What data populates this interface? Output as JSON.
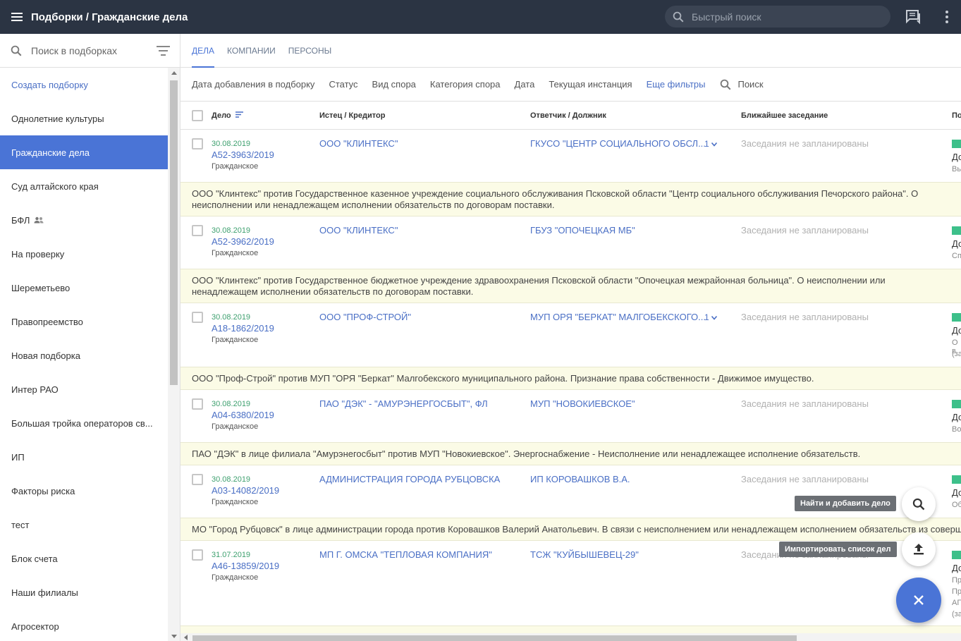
{
  "header": {
    "title": "Подборки / Гражданские дела",
    "search_placeholder": "Быстрый поиск",
    "menu_icon": "menu-icon",
    "chat_icon": "chat-icon",
    "more_icon": "more-vert-icon"
  },
  "sidebar": {
    "search_placeholder": "Поиск в подборках",
    "items": [
      {
        "label": "Создать подборку"
      },
      {
        "label": "Однолетние культуры"
      },
      {
        "label": "Гражданские дела"
      },
      {
        "label": "Суд алтайского края"
      },
      {
        "label": "БФЛ"
      },
      {
        "label": "На проверку"
      },
      {
        "label": "Шереметьево"
      },
      {
        "label": "Правопреемство"
      },
      {
        "label": "Новая подборка"
      },
      {
        "label": "Интер РАО"
      },
      {
        "label": "Большая тройка операторов св..."
      },
      {
        "label": "ИП"
      },
      {
        "label": "Факторы риска"
      },
      {
        "label": "тест"
      },
      {
        "label": "Блок счета"
      },
      {
        "label": "Наши филиалы"
      },
      {
        "label": "Агросектор"
      }
    ]
  },
  "tabs": [
    "ДЕЛА",
    "КОМПАНИИ",
    "ПЕРСОНЫ"
  ],
  "filters": [
    "Дата добавления в подборку",
    "Статус",
    "Вид спора",
    "Категория спора",
    "Дата",
    "Текущая инстанция",
    "Еще фильтры",
    "Поиск"
  ],
  "table": {
    "columns": [
      "Дело",
      "Истец / Кредитор",
      "Ответчик / Должник",
      "Ближайшее заседание",
      "По"
    ],
    "rows": [
      {
        "date": "30.08.2019",
        "number": "А52-3963/2019",
        "type": "Гражданское",
        "plaintiff": "ООО \"КЛИНТЕКС\"",
        "defendant": "ГКУСО \"ЦЕНТР СОЦИАЛЬНОГО ОБСЛ...",
        "extra": "1",
        "hearing": "Заседания не запланированы",
        "last1": "До",
        "last2": "Вы",
        "description": "ООО \"Клинтекс\" против Государственное казенное учреждение социального обслуживания Псковской области \"Центр социального обслуживания Печорского района\". О неисполнении или ненадлежащем исполнении обязательств по договорам поставки."
      },
      {
        "date": "30.08.2019",
        "number": "А52-3962/2019",
        "type": "Гражданское",
        "plaintiff": "ООО \"КЛИНТЕКС\"",
        "defendant": "ГБУЗ \"ОПОЧЕЦКАЯ МБ\"",
        "extra": "",
        "hearing": "Заседания не запланированы",
        "last1": "До",
        "last2": "Сп",
        "description": "ООО \"Клинтекс\" против Государственное бюджетное учреждение здравоохранения Псковской области \"Опочецкая межрайонная больница\". О неисполнении или ненадлежащем исполнении обязательств по договорам поставки."
      },
      {
        "date": "30.08.2019",
        "number": "А18-1862/2019",
        "type": "Гражданское",
        "plaintiff": "ООО \"ПРОФ-СТРОЙ\"",
        "defendant": "МУП ОРЯ \"БЕРКАТ\" МАЛГОБЕКСКОГО...",
        "extra": "1",
        "hearing": "Заседания не запланированы",
        "last1": "До",
        "last2": "О в",
        "last3": "(за",
        "description": "ООО \"Проф-Строй\" против МУП \"ОРЯ \"Беркат\" Малгобекского муниципального района. Признание права собственности - Движимое имущество."
      },
      {
        "date": "30.08.2019",
        "number": "А04-6380/2019",
        "type": "Гражданское",
        "plaintiff": "ПАО \"ДЭК\" - \"АМУРЭНЕРГОСБЫТ\", ФЛ",
        "defendant": "МУП \"НОВОКИЕВСКОЕ\"",
        "extra": "",
        "hearing": "Заседания не запланированы",
        "last1": "До",
        "last2": "Во",
        "description": "ПАО \"ДЭК\" в лице филиала \"Амурэнегосбыт\" против МУП \"Новокиевское\". Энергоснабжение - Неисполнение или ненадлежащее исполнение обязательств."
      },
      {
        "date": "30.08.2019",
        "number": "А03-14082/2019",
        "type": "Гражданское",
        "plaintiff": "АДМИНИСТРАЦИЯ ГОРОДА РУБЦОВСКА",
        "defendant": "ИП КОРОВАШКОВ В.А.",
        "extra": "",
        "hearing": "Заседания не запланированы",
        "last1": "До",
        "last2": "Об",
        "description": "МО \"Город Рубцовск\" в лице администрации города против Коровашков Валерий Анатольевич. В связи с неисполнением или ненадлежащем исполнением обязательств из совершенных сделок"
      },
      {
        "date": "31.07.2019",
        "number": "А46-13859/2019",
        "type": "Гражданское",
        "plaintiff": "МП Г. ОМСКА \"ТЕПЛОВАЯ КОМПАНИЯ\"",
        "defendant": "ТСЖ \"КУЙБЫШЕВЕЦ-29\"",
        "extra": "",
        "hearing": "Заседания не запланированы",
        "last1": "До",
        "last2": "Пр",
        "last3": "Пр",
        "last4": "АГ",
        "last5": "(за",
        "description": ""
      }
    ]
  },
  "fab": {
    "find_tooltip": "Найти и добавить дело",
    "import_tooltip": "Импортировать список дел",
    "accent": "#4a74d6"
  }
}
